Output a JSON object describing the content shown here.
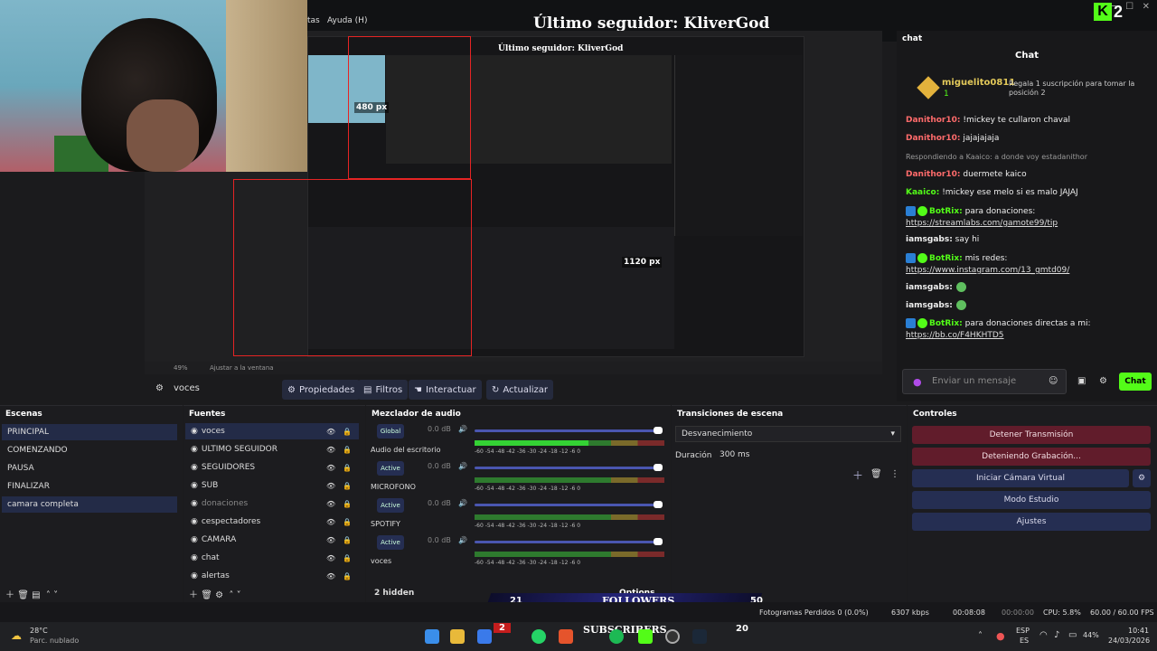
{
  "menubar": {
    "help_menu": "Ayuda (H)",
    "prev_menu": "tas"
  },
  "overlay": {
    "title": "Último seguidor: KliverGod",
    "logo_k": "K",
    "logo_num": "2"
  },
  "preview": {
    "mini_title": "Último seguidor: KliverGod",
    "label_480": "480 px",
    "label_1120": "1120 px",
    "zoom": "49%",
    "fit": "Ajustar a la ventana"
  },
  "toolbar": {
    "source": "voces",
    "props": "Propiedades",
    "filters": "Filtros",
    "interact": "Interactuar",
    "refresh": "Actualizar"
  },
  "chat": {
    "header": "chat",
    "title": "Chat",
    "pinned_user": "miguelito0811",
    "pinned_count": "1",
    "pinned_text": "Regala 1 suscripción para tomar la posición 2",
    "messages": [
      {
        "user": "Danithor10:",
        "text": " !mickey te cullaron chaval",
        "type": "red"
      },
      {
        "user": "Danithor10:",
        "text": " jajajajaja",
        "type": "red"
      },
      {
        "reply": "Respondiendo a Kaaico: a donde voy estadanithor"
      },
      {
        "user": "Danithor10:",
        "text": " duermete kaico",
        "type": "red"
      },
      {
        "user": "Kaaico:",
        "text": " !mickey ese melo si es malo JAJAJ",
        "type": "green"
      },
      {
        "user": "BotRix:",
        "text": " para donaciones:",
        "type": "bot"
      },
      {
        "link": "https://streamlabs.com/gamote99/tip"
      },
      {
        "user": "iamsgabs:",
        "text": " say hi",
        "type": "white"
      },
      {
        "user": "BotRix:",
        "text": " mis redes:",
        "type": "bot"
      },
      {
        "link": "https://www.instagram.com/13_gmtd09/"
      },
      {
        "user": "iamsgabs:",
        "text": "",
        "type": "white"
      },
      {
        "user": "iamsgabs:",
        "text": "",
        "type": "white"
      },
      {
        "user": "BotRix:",
        "text": " para donaciones directas a mi:",
        "type": "bot"
      },
      {
        "link": "https://bb.co/F4HKHTD5"
      }
    ],
    "input_placeholder": "Enviar un mensaje",
    "send": "Chat"
  },
  "scenes": {
    "title": "Escenas",
    "items": [
      "PRINCIPAL",
      "COMENZANDO",
      "PAUSA",
      "FINALIZAR",
      "camara completa"
    ]
  },
  "sources": {
    "title": "Fuentes",
    "items": [
      "voces",
      "ULTIMO SEGUIDOR",
      "SEGUIDORES",
      "SUB",
      "donaciones",
      "cespectadores",
      "CAMARA",
      "chat",
      "alertas"
    ]
  },
  "mixer": {
    "title": "Mezclador de audio",
    "channels": [
      {
        "btn": "Global",
        "name": "Audio del escritorio",
        "db": "0.0 dB"
      },
      {
        "btn": "Active",
        "name": "MICROFONO",
        "db": "0.0 dB"
      },
      {
        "btn": "Active",
        "name": "SPOTIFY",
        "db": "0.0 dB"
      },
      {
        "btn": "Active",
        "name": "voces",
        "db": "0.0 dB"
      }
    ],
    "scale": "-60  -54  -48  -42  -36  -30  -24  -18  -12  -6   0",
    "hidden": "2 hidden",
    "options": "Options"
  },
  "transitions": {
    "title": "Transiciones de escena",
    "selected": "Desvanecimiento",
    "duration_label": "Duración",
    "duration": "300 ms"
  },
  "controls": {
    "title": "Controles",
    "stop_stream": "Detener Transmisión",
    "stop_rec": "Deteniendo Grabación...",
    "virtual_cam": "Iniciar Cámara Virtual",
    "studio": "Modo Estudio",
    "settings": "Ajustes"
  },
  "overlay_bar": {
    "count1": "21",
    "label1": "FOLLOWERS",
    "count2": "50",
    "label2": "SUBSCRIBERS",
    "count3": "2",
    "count4": "20"
  },
  "status": {
    "frames": "Fotogramas Perdidos 0 (0.0%)",
    "bitrate": "6307 kbps",
    "time1": "00:08:08",
    "time2": "00:00:00",
    "cpu": "CPU: 5.8%",
    "fps": "60.00 / 60.00 FPS"
  },
  "taskbar": {
    "temp": "28°C",
    "weather": "Parc. nublado",
    "lang1": "ESP",
    "lang2": "ES",
    "battery": "44%",
    "clock": "10:41",
    "date": "24/03/2026"
  }
}
